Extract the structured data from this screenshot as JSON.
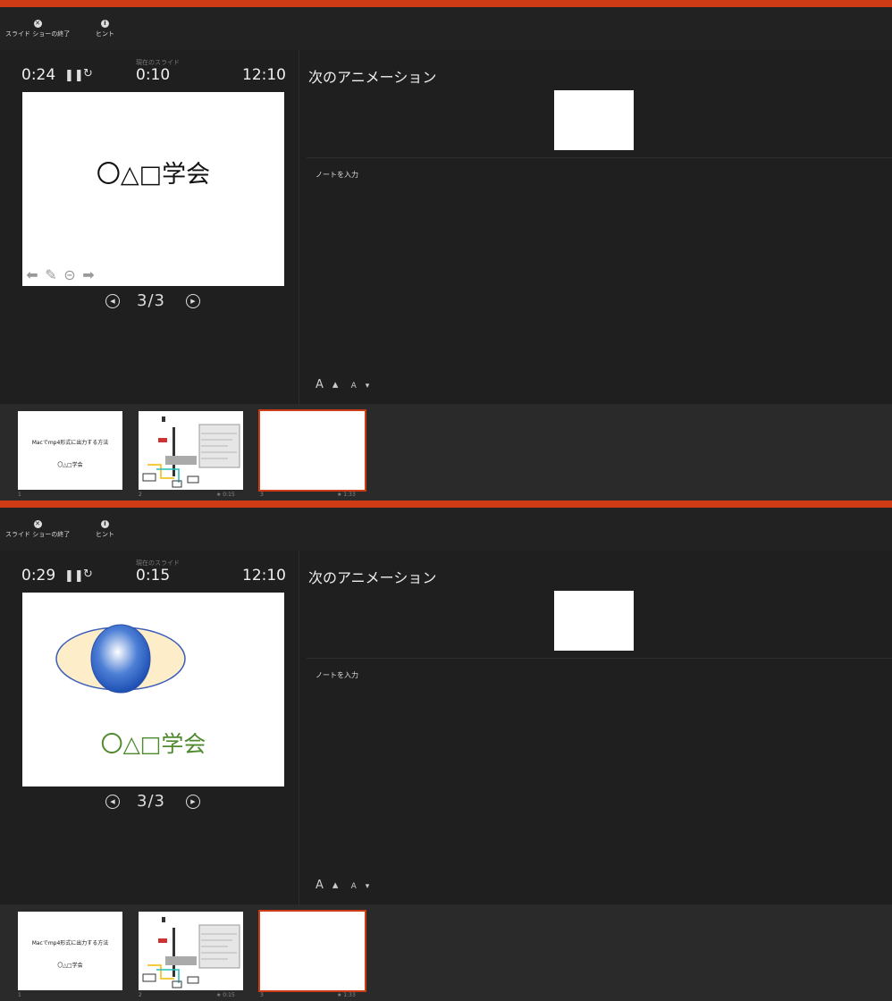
{
  "toolbar": {
    "end_show_label": "スライド ショーの終了",
    "hint_label": "ヒント"
  },
  "panels": [
    {
      "elapsed": "0:24",
      "current_label": "現在のスライド",
      "current_time": "0:10",
      "clock": "12:10",
      "slide_title": "〇△□学会",
      "slide_counter": "3/3",
      "next_title": "次のアニメーション",
      "notes_placeholder": "ノートを入力",
      "font_up": "A",
      "font_down": "A"
    },
    {
      "elapsed": "0:29",
      "current_label": "現在のスライド",
      "current_time": "0:15",
      "clock": "12:10",
      "slide_title": "〇△□学会",
      "slide_counter": "3/3",
      "next_title": "次のアニメーション",
      "notes_placeholder": "ノートを入力",
      "font_up": "A",
      "font_down": "A"
    }
  ],
  "thumbs": [
    {
      "num": "1",
      "title": "Macでmp4形式に出力する方法",
      "subtitle": "〇△□学会",
      "time": ""
    },
    {
      "num": "2",
      "time": "★ 0:15"
    },
    {
      "num": "3",
      "time": "★ 1:33"
    }
  ]
}
